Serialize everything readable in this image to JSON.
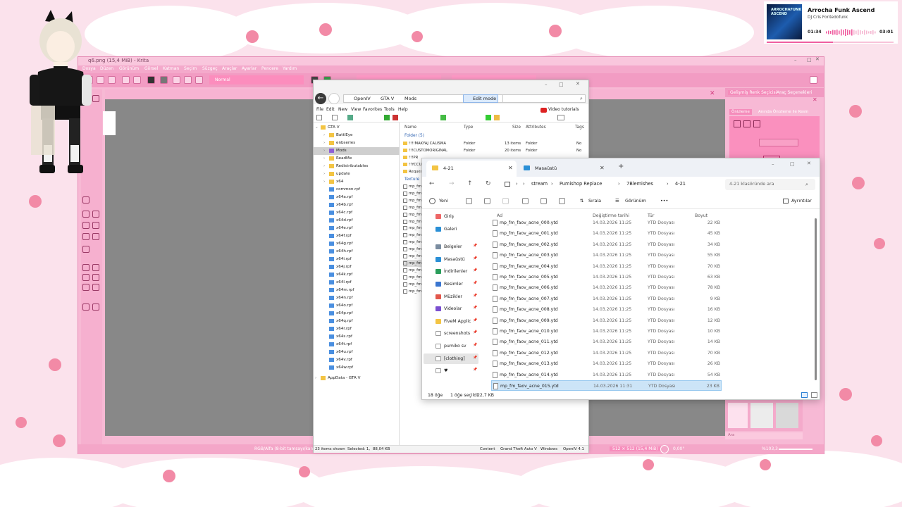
{
  "krita": {
    "title": "q6.png (15,4 MiB) - Krita",
    "menu": [
      "Dosya",
      "Düzen",
      "Görünüm",
      "Görsel",
      "Katman",
      "Seçim",
      "Süzgeç",
      "Araçlar",
      "Ayarlar",
      "Pencere",
      "Yardım"
    ],
    "blend_mode": "Normal",
    "dock_tabs": [
      "Gelişmiş Renk Seçicisi",
      "Araç Seçenekleri"
    ],
    "dock_subtabs": [
      "Önizleme",
      "Anında Önizleme ile Kesin"
    ],
    "status_left": "RGB/Alfa (8-bit tamsayı/kanal), sRGB-elle-V2g10.icc",
    "status_right": "512 × 512 (15,4 MiB)",
    "zoom": "0,00°",
    "zoom_pct": "%103,3",
    "search_placeholder": "Ara",
    "colors": {
      "bg": "#f7b9d4",
      "canvas": "#888888",
      "accent": "#fc8dbd"
    }
  },
  "openiv": {
    "breadcrumb": [
      "OpenIV",
      "GTA V",
      "Mods"
    ],
    "edit_mode": "Edit mode",
    "menu": [
      "File",
      "Edit",
      "New",
      "View",
      "Favorites",
      "Tools",
      "Help"
    ],
    "video_tutorials": "Video tutorials",
    "tree": [
      {
        "label": "GTA V",
        "depth": 0,
        "type": "folder-open"
      },
      {
        "label": "BattlEye",
        "depth": 1,
        "type": "folder"
      },
      {
        "label": "enbseries",
        "depth": 1,
        "type": "folder"
      },
      {
        "label": "Mods",
        "depth": 1,
        "type": "mods",
        "selected": true
      },
      {
        "label": "ReadMe",
        "depth": 1,
        "type": "folder"
      },
      {
        "label": "Redistributables",
        "depth": 1,
        "type": "folder"
      },
      {
        "label": "update",
        "depth": 1,
        "type": "folder"
      },
      {
        "label": "x64",
        "depth": 1,
        "type": "folder"
      },
      {
        "label": "common.rpf",
        "depth": 1,
        "type": "rpf"
      },
      {
        "label": "x64a.rpf",
        "depth": 1,
        "type": "rpf"
      },
      {
        "label": "x64b.rpf",
        "depth": 1,
        "type": "rpf"
      },
      {
        "label": "x64c.rpf",
        "depth": 1,
        "type": "rpf"
      },
      {
        "label": "x64d.rpf",
        "depth": 1,
        "type": "rpf"
      },
      {
        "label": "x64e.rpf",
        "depth": 1,
        "type": "rpf"
      },
      {
        "label": "x64f.rpf",
        "depth": 1,
        "type": "rpf"
      },
      {
        "label": "x64g.rpf",
        "depth": 1,
        "type": "rpf"
      },
      {
        "label": "x64h.rpf",
        "depth": 1,
        "type": "rpf"
      },
      {
        "label": "x64i.rpf",
        "depth": 1,
        "type": "rpf"
      },
      {
        "label": "x64j.rpf",
        "depth": 1,
        "type": "rpf"
      },
      {
        "label": "x64k.rpf",
        "depth": 1,
        "type": "rpf"
      },
      {
        "label": "x64l.rpf",
        "depth": 1,
        "type": "rpf"
      },
      {
        "label": "x64m.rpf",
        "depth": 1,
        "type": "rpf"
      },
      {
        "label": "x64n.rpf",
        "depth": 1,
        "type": "rpf"
      },
      {
        "label": "x64o.rpf",
        "depth": 1,
        "type": "rpf"
      },
      {
        "label": "x64p.rpf",
        "depth": 1,
        "type": "rpf"
      },
      {
        "label": "x64q.rpf",
        "depth": 1,
        "type": "rpf"
      },
      {
        "label": "x64r.rpf",
        "depth": 1,
        "type": "rpf"
      },
      {
        "label": "x64s.rpf",
        "depth": 1,
        "type": "rpf"
      },
      {
        "label": "x64t.rpf",
        "depth": 1,
        "type": "rpf"
      },
      {
        "label": "x64u.rpf",
        "depth": 1,
        "type": "rpf"
      },
      {
        "label": "x64v.rpf",
        "depth": 1,
        "type": "rpf"
      },
      {
        "label": "x64w.rpf",
        "depth": 1,
        "type": "rpf"
      },
      {
        "label": "AppData - GTA V",
        "depth": 0,
        "type": "folder-app"
      }
    ],
    "columns": [
      "Name",
      "Type",
      "Size",
      "Attributes",
      "Tags"
    ],
    "group_folders": "Folder (5)",
    "group_textures": "Texture",
    "folders": [
      {
        "name": "!!!!MAKYAJ CALISMA",
        "type": "Folder",
        "size": "13 items",
        "attr": "Folder",
        "tags": "No"
      },
      {
        "name": "!!!CUSTOMORIGINAL",
        "type": "Folder",
        "size": "20 items",
        "attr": "Folder",
        "tags": "No"
      },
      {
        "name": "!!!PR",
        "type": "",
        "size": "",
        "attr": "",
        "tags": ""
      },
      {
        "name": "!!YCCUS",
        "type": "",
        "size": "",
        "attr": "",
        "tags": ""
      },
      {
        "name": "Reques",
        "type": "",
        "size": "",
        "attr": "",
        "tags": ""
      }
    ],
    "texture_rows": [
      "mp_fm",
      "mp_fm",
      "mp_fm",
      "mp_fm",
      "mp_fm",
      "mp_fm",
      "mp_fm",
      "mp_fm",
      "mp_fm",
      "mp_fm",
      "mp_fm",
      "mp_fm",
      "mp_fm",
      "mp_fm",
      "mp_fm",
      "mp_fm"
    ],
    "status": {
      "items": "23 items shown",
      "selected": "Selected: 1,",
      "size": "88,04 KB",
      "content": "Content",
      "game": "Grand Theft Auto V",
      "platform": "Windows",
      "version": "OpenIV 4.1"
    }
  },
  "explorer": {
    "tabs": [
      {
        "label": "4-21",
        "active": true
      },
      {
        "label": "Masaüstü",
        "active": false
      }
    ],
    "breadcrumb": [
      "stream",
      "Pumishop Replace",
      "7Blemishes",
      "4-21"
    ],
    "search_placeholder": "4-21 klasöründe ara",
    "cmd": {
      "new": "Yeni",
      "sort": "Sırala",
      "view": "Görünüm",
      "more": "•••",
      "details": "Ayrıntılar"
    },
    "nav": [
      {
        "label": "Giriş",
        "icon": "home-icon",
        "pinned": false
      },
      {
        "label": "Galeri",
        "icon": "gallery-icon",
        "pinned": false
      },
      {
        "label": "Belgeler",
        "icon": "documents-icon",
        "pinned": true
      },
      {
        "label": "Masaüstü",
        "icon": "desktop-icon",
        "pinned": true
      },
      {
        "label": "İndirilenler",
        "icon": "download-icon",
        "pinned": true
      },
      {
        "label": "Resimler",
        "icon": "pictures-icon",
        "pinned": true
      },
      {
        "label": "Müzikler",
        "icon": "music-icon",
        "pinned": true
      },
      {
        "label": "Videolar",
        "icon": "videos-icon",
        "pinned": true
      },
      {
        "label": "FiveM Applic",
        "icon": "folder-icon",
        "pinned": true
      },
      {
        "label": "screenshots",
        "icon": "folder-icon",
        "pinned": true
      },
      {
        "label": "pumiko sv",
        "icon": "folder-icon",
        "pinned": true
      },
      {
        "label": "[clothing]",
        "icon": "folder-icon",
        "pinned": true,
        "selected": true
      },
      {
        "label": "♥",
        "icon": "folder-icon",
        "pinned": true
      }
    ],
    "columns": [
      "Ad",
      "Değiştirme tarihi",
      "Tür",
      "Boyut"
    ],
    "files": [
      {
        "name": "mp_fm_faov_acne_000.ytd",
        "date": "14.03.2026 11:25",
        "type": "YTD Dosyası",
        "size": "22 KB"
      },
      {
        "name": "mp_fm_faov_acne_001.ytd",
        "date": "14.03.2026 11:25",
        "type": "YTD Dosyası",
        "size": "45 KB"
      },
      {
        "name": "mp_fm_faov_acne_002.ytd",
        "date": "14.03.2026 11:25",
        "type": "YTD Dosyası",
        "size": "34 KB"
      },
      {
        "name": "mp_fm_faov_acne_003.ytd",
        "date": "14.03.2026 11:25",
        "type": "YTD Dosyası",
        "size": "55 KB"
      },
      {
        "name": "mp_fm_faov_acne_004.ytd",
        "date": "14.03.2026 11:25",
        "type": "YTD Dosyası",
        "size": "70 KB"
      },
      {
        "name": "mp_fm_faov_acne_005.ytd",
        "date": "14.03.2026 11:25",
        "type": "YTD Dosyası",
        "size": "63 KB"
      },
      {
        "name": "mp_fm_faov_acne_006.ytd",
        "date": "14.03.2026 11:25",
        "type": "YTD Dosyası",
        "size": "78 KB"
      },
      {
        "name": "mp_fm_faov_acne_007.ytd",
        "date": "14.03.2026 11:25",
        "type": "YTD Dosyası",
        "size": "9 KB"
      },
      {
        "name": "mp_fm_faov_acne_008.ytd",
        "date": "14.03.2026 11:25",
        "type": "YTD Dosyası",
        "size": "16 KB"
      },
      {
        "name": "mp_fm_faov_acne_009.ytd",
        "date": "14.03.2026 11:25",
        "type": "YTD Dosyası",
        "size": "12 KB"
      },
      {
        "name": "mp_fm_faov_acne_010.ytd",
        "date": "14.03.2026 11:25",
        "type": "YTD Dosyası",
        "size": "10 KB"
      },
      {
        "name": "mp_fm_faov_acne_011.ytd",
        "date": "14.03.2026 11:25",
        "type": "YTD Dosyası",
        "size": "14 KB"
      },
      {
        "name": "mp_fm_faov_acne_012.ytd",
        "date": "14.03.2026 11:25",
        "type": "YTD Dosyası",
        "size": "70 KB"
      },
      {
        "name": "mp_fm_faov_acne_013.ytd",
        "date": "14.03.2026 11:25",
        "type": "YTD Dosyası",
        "size": "26 KB"
      },
      {
        "name": "mp_fm_faov_acne_014.ytd",
        "date": "14.03.2026 11:25",
        "type": "YTD Dosyası",
        "size": "54 KB"
      },
      {
        "name": "mp_fm_faov_acne_015.ytd",
        "date": "14.03.2026 11:31",
        "type": "YTD Dosyası",
        "size": "23 KB",
        "selected": true
      }
    ],
    "status": {
      "count": "18 öğe",
      "selected": "1 öğe seçildi",
      "size": "22,7 KB"
    }
  },
  "now_playing": {
    "title": "Arrocha Funk Ascend",
    "artist": "DJ Cris Fontedofunk",
    "album_art_text": "ARROCHAFUNK ASCEND",
    "elapsed": "01:34",
    "duration": "03:01",
    "progress": 0.52,
    "accent": "#ef5ea0"
  }
}
